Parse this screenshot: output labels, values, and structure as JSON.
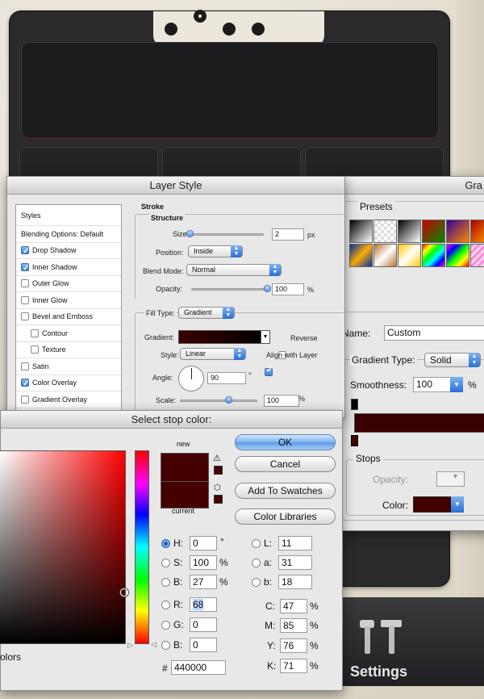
{
  "background_app": {
    "settings_label": "Settings",
    "colors": {
      "device": "#2a2a2c",
      "paper": "#e8e4d8"
    }
  },
  "layer_style": {
    "title": "Layer Style",
    "styles_header": "Styles",
    "items": [
      {
        "label": "Blending Options: Default",
        "checkbox": false,
        "checked": false,
        "indent": false
      },
      {
        "label": "Drop Shadow",
        "checkbox": true,
        "checked": true,
        "indent": false
      },
      {
        "label": "Inner Shadow",
        "checkbox": true,
        "checked": true,
        "indent": false
      },
      {
        "label": "Outer Glow",
        "checkbox": true,
        "checked": false,
        "indent": false
      },
      {
        "label": "Inner Glow",
        "checkbox": true,
        "checked": false,
        "indent": false
      },
      {
        "label": "Bevel and Emboss",
        "checkbox": true,
        "checked": false,
        "indent": false
      },
      {
        "label": "Contour",
        "checkbox": true,
        "checked": false,
        "indent": true
      },
      {
        "label": "Texture",
        "checkbox": true,
        "checked": false,
        "indent": true
      },
      {
        "label": "Satin",
        "checkbox": true,
        "checked": false,
        "indent": false
      },
      {
        "label": "Color Overlay",
        "checkbox": true,
        "checked": true,
        "indent": false
      },
      {
        "label": "Gradient Overlay",
        "checkbox": true,
        "checked": false,
        "indent": false
      }
    ],
    "stroke": {
      "section": "Stroke",
      "structure": "Structure",
      "size_label": "Size:",
      "size_value": "2",
      "size_unit": "px",
      "position_label": "Position:",
      "position_value": "Inside",
      "blend_label": "Blend Mode:",
      "blend_value": "Normal",
      "opacity_label": "Opacity:",
      "opacity_value": "100",
      "opacity_unit": "%",
      "fill_type_label": "Fill Type:",
      "fill_type_value": "Gradient",
      "gradient_label": "Gradient:",
      "reverse_label": "Reverse",
      "style_label": "Style:",
      "style_value": "Linear",
      "align_label": "Align with Layer",
      "angle_label": "Angle:",
      "angle_value": "90",
      "angle_unit": "°",
      "scale_label": "Scale:",
      "scale_value": "100",
      "scale_unit": "%"
    }
  },
  "gradient_editor": {
    "title": "Gra",
    "presets_label": "Presets",
    "name_label": "Name:",
    "name_value": "Custom",
    "type_label": "Gradient Type:",
    "type_value": "Solid",
    "smooth_label": "Smoothness:",
    "smooth_value": "100",
    "smooth_unit": "%",
    "stops_label": "Stops",
    "opacity_label": "Opacity:",
    "color_label": "Color:",
    "stop_color": "#440000"
  },
  "stop_color": {
    "title": "Select stop color:",
    "new_label": "new",
    "current_label": "current",
    "ok": "OK",
    "cancel": "Cancel",
    "add_swatches": "Add To Swatches",
    "color_libraries": "Color Libraries",
    "colors_label": "olors",
    "hex_label": "#",
    "hex_value": "440000",
    "fields": {
      "H": {
        "label": "H:",
        "value": "0",
        "unit": "°"
      },
      "S": {
        "label": "S:",
        "value": "100",
        "unit": "%"
      },
      "B": {
        "label": "B:",
        "value": "27",
        "unit": "%"
      },
      "R": {
        "label": "R:",
        "value": "68",
        "unit": ""
      },
      "G": {
        "label": "G:",
        "value": "0",
        "unit": ""
      },
      "Bl": {
        "label": "B:",
        "value": "0",
        "unit": ""
      },
      "L": {
        "label": "L:",
        "value": "11",
        "unit": ""
      },
      "a": {
        "label": "a:",
        "value": "31",
        "unit": ""
      },
      "b": {
        "label": "b:",
        "value": "18",
        "unit": ""
      },
      "C": {
        "label": "C:",
        "value": "47",
        "unit": "%"
      },
      "M": {
        "label": "M:",
        "value": "85",
        "unit": "%"
      },
      "Y": {
        "label": "Y:",
        "value": "76",
        "unit": "%"
      },
      "K": {
        "label": "K:",
        "value": "71",
        "unit": "%"
      }
    },
    "new_color": "#440000",
    "current_color": "#440000"
  }
}
